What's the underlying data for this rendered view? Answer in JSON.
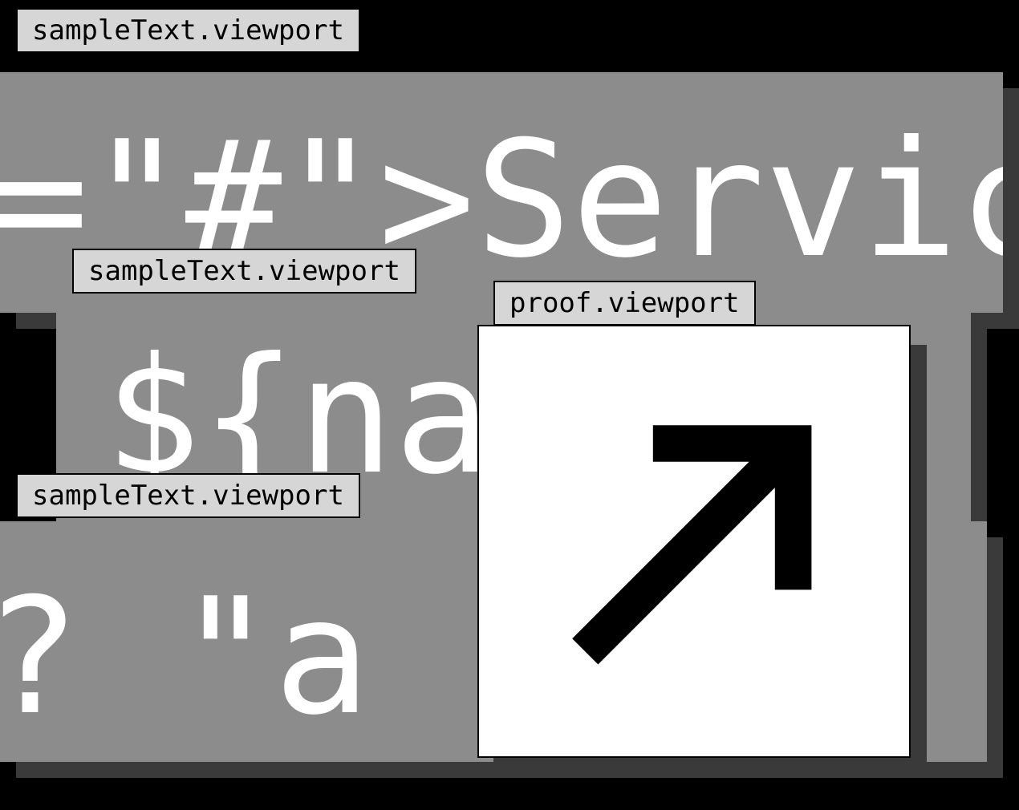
{
  "windows": {
    "sample1": {
      "tab_label": "sampleText.viewport",
      "text": "=\"#\">Service"
    },
    "sample2": {
      "tab_label": "sampleText.viewport",
      "text": "${name"
    },
    "sample3": {
      "tab_label": "sampleText.viewport",
      "text": "? \"a is"
    },
    "proof": {
      "tab_label": "proof.viewport",
      "glyph_name": "arrow-up-right"
    }
  }
}
